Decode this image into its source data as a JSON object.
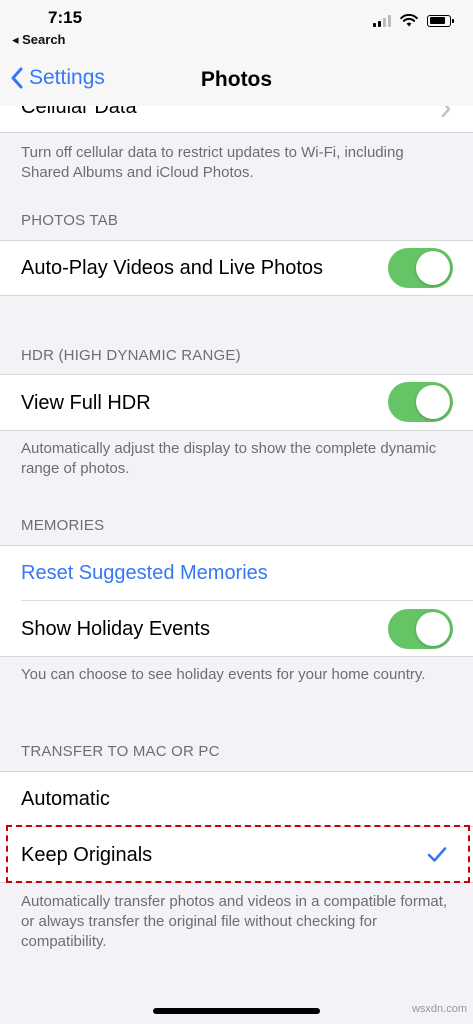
{
  "status_bar": {
    "time": "7:15",
    "back_app": "◂ Search",
    "battery_level": 0.85
  },
  "nav": {
    "back_label": "Settings",
    "title": "Photos"
  },
  "cellular": {
    "label": "Cellular Data",
    "footer": "Turn off cellular data to restrict updates to Wi-Fi, including Shared Albums and iCloud Photos."
  },
  "photos_tab": {
    "header": "PHOTOS TAB",
    "autoplay_label": "Auto-Play Videos and Live Photos",
    "autoplay_on": true
  },
  "hdr": {
    "header": "HDR (HIGH DYNAMIC RANGE)",
    "view_full_hdr_label": "View Full HDR",
    "view_full_hdr_on": true,
    "footer": "Automatically adjust the display to show the complete dynamic range of photos."
  },
  "memories": {
    "header": "MEMORIES",
    "reset_label": "Reset Suggested Memories",
    "holiday_label": "Show Holiday Events",
    "holiday_on": true,
    "footer": "You can choose to see holiday events for your home country."
  },
  "transfer": {
    "header": "TRANSFER TO MAC OR PC",
    "automatic_label": "Automatic",
    "keep_originals_label": "Keep Originals",
    "selected": "Keep Originals",
    "footer": "Automatically transfer photos and videos in a compatible format, or always transfer the original file without checking for compatibility."
  },
  "watermark": "wsxdn.com",
  "colors": {
    "accent": "#3478f6",
    "toggle_on": "#65c466",
    "background": "#f2f2f7",
    "highlight": "#cc0000"
  },
  "icons": [
    "chevron-left-icon",
    "chevron-right-icon",
    "checkmark-icon",
    "wifi-icon",
    "signal-icon",
    "battery-icon"
  ]
}
